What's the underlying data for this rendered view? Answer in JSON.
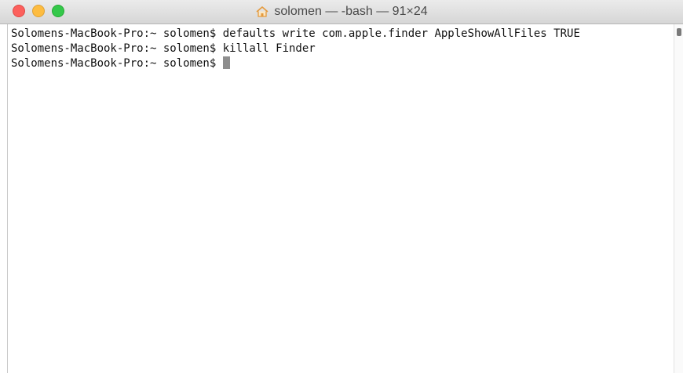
{
  "window": {
    "title": "solomen — -bash — 91×24"
  },
  "terminal": {
    "lines": [
      "Solomens-MacBook-Pro:~ solomen$ defaults write com.apple.finder AppleShowAllFiles TRUE",
      "Solomens-MacBook-Pro:~ solomen$ killall Finder",
      "Solomens-MacBook-Pro:~ solomen$ "
    ]
  },
  "colors": {
    "close": "#fc605c",
    "minimize": "#fdbc40",
    "maximize": "#34c84a",
    "home_icon": "#e59a3c"
  },
  "icons": {
    "title_icon": "home-icon"
  }
}
